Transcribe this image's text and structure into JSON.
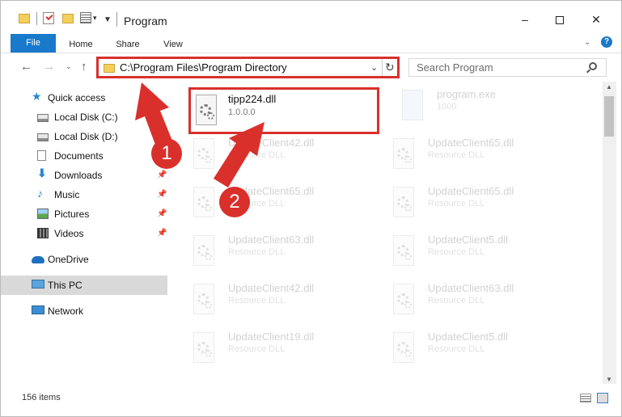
{
  "title": "Program",
  "window_buttons": {
    "minimize": "–",
    "close": "✕"
  },
  "ribbon": {
    "tabs": [
      "File",
      "Home",
      "Share",
      "View"
    ],
    "help": "?",
    "chevron": "⌄"
  },
  "nav": {
    "back": "←",
    "forward": "→",
    "recent": "⌄",
    "up": "↑"
  },
  "address": {
    "path": "C:\\Program Files\\Program Directory",
    "dropdown": "⌄",
    "refresh": "↻"
  },
  "search": {
    "placeholder": "Search Program"
  },
  "sidebar": {
    "items": [
      {
        "label": "Quick access"
      },
      {
        "label": "Local Disk (C:)"
      },
      {
        "label": "Local Disk (D:)"
      },
      {
        "label": "Documents"
      },
      {
        "label": "Downloads"
      },
      {
        "label": "Music"
      },
      {
        "label": "Pictures"
      },
      {
        "label": "Videos"
      },
      {
        "label": "OneDrive"
      },
      {
        "label": "This PC"
      },
      {
        "label": "Network"
      }
    ],
    "pin": "📌"
  },
  "files": {
    "highlighted": {
      "name": "tipp224.dll",
      "sub": "1.0.0.0"
    },
    "exe": {
      "name": "program.exe",
      "sub": "1000"
    },
    "left": [
      {
        "name": "UpdateClient42.dll",
        "sub": "Resource DLL"
      },
      {
        "name": "UpdateClient65.dll",
        "sub": "Resource DLL"
      },
      {
        "name": "UpdateClient63.dll",
        "sub": "Resource DLL"
      },
      {
        "name": "UpdateClient42.dll",
        "sub": "Resource DLL"
      },
      {
        "name": "UpdateClient19.dll",
        "sub": "Resource DLL"
      }
    ],
    "right": [
      {
        "name": "UpdateClient65.dll",
        "sub": "Resource DLL"
      },
      {
        "name": "UpdateClient65.dll",
        "sub": "Resource DLL"
      },
      {
        "name": "UpdateClient5.dll",
        "sub": "Resource DLL"
      },
      {
        "name": "UpdateClient63.dll",
        "sub": "Resource DLL"
      },
      {
        "name": "UpdateClient5.dll",
        "sub": "Resource DLL"
      }
    ]
  },
  "status": {
    "count": "156 items"
  },
  "annotations": {
    "step1": "1",
    "step2": "2",
    "color": "#d9302c"
  }
}
